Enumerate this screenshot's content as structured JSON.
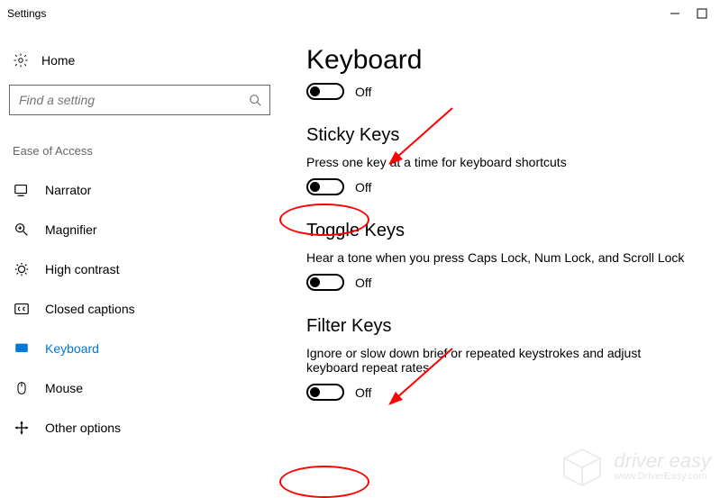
{
  "window": {
    "title": "Settings"
  },
  "sidebar": {
    "home": "Home",
    "search_placeholder": "Find a setting",
    "group_header": "Ease of Access",
    "items": [
      {
        "label": "Narrator"
      },
      {
        "label": "Magnifier"
      },
      {
        "label": "High contrast"
      },
      {
        "label": "Closed captions"
      },
      {
        "label": "Keyboard"
      },
      {
        "label": "Mouse"
      },
      {
        "label": "Other options"
      }
    ]
  },
  "main": {
    "title": "Keyboard",
    "toggle_state": "Off",
    "sections": [
      {
        "title": "Sticky Keys",
        "desc": "Press one key at a time for keyboard shortcuts",
        "state": "Off"
      },
      {
        "title": "Toggle Keys",
        "desc": "Hear a tone when you press Caps Lock, Num Lock, and Scroll Lock",
        "state": "Off"
      },
      {
        "title": "Filter Keys",
        "desc": "Ignore or slow down brief or repeated keystrokes and adjust keyboard repeat rates",
        "state": "Off"
      }
    ]
  },
  "watermark": {
    "brand": "driver easy",
    "url": "www.DriverEasy.com"
  }
}
